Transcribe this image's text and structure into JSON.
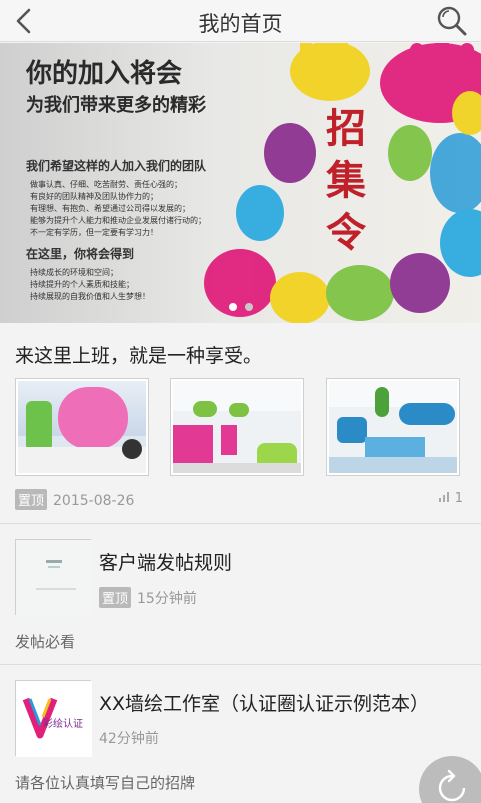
{
  "nav": {
    "title": "我的首页",
    "back_icon": "chevron-left-icon",
    "search_icon": "search-icon"
  },
  "banner": {
    "headline": "你的加入将会",
    "subheadline": "为我们带来更多的精彩",
    "call": "我们希望这样的人加入我们的团队",
    "lines": [
      "做事认真、仔细、吃苦耐劳、责任心强的；",
      "有良好的团队精神及团队协作力的；",
      "有理想、有抱负、希望通过公司得以发展的；",
      "能够为提升个人能力和推动企业发展付诸行动的；",
      "不一定有学历，但一定要有学习力！"
    ],
    "gain_title": "在这里，你将会得到",
    "gains": [
      "持续成长的环境和空间；",
      "持续提升的个人素质和技能；",
      "持续展现的自我价值和人生梦想！"
    ],
    "big_title": "招集令",
    "page_count": 2,
    "active_page": 1
  },
  "post1": {
    "headline": "来这里上班，就是一种享受。",
    "tag": "置顶",
    "date": "2015-08-26",
    "views": "1"
  },
  "post2": {
    "title": "客户端发帖规则",
    "tag": "置顶",
    "ago": "15分钟前",
    "summary": "发帖必看"
  },
  "post3": {
    "title": "XX墙绘工作室（认证圈认证示例范本）",
    "ago": "42分钟前",
    "summary": "请各位认真填写自己的招牌",
    "logo_text": "彩绘认证"
  },
  "fab": {
    "icon": "refresh-icon"
  }
}
